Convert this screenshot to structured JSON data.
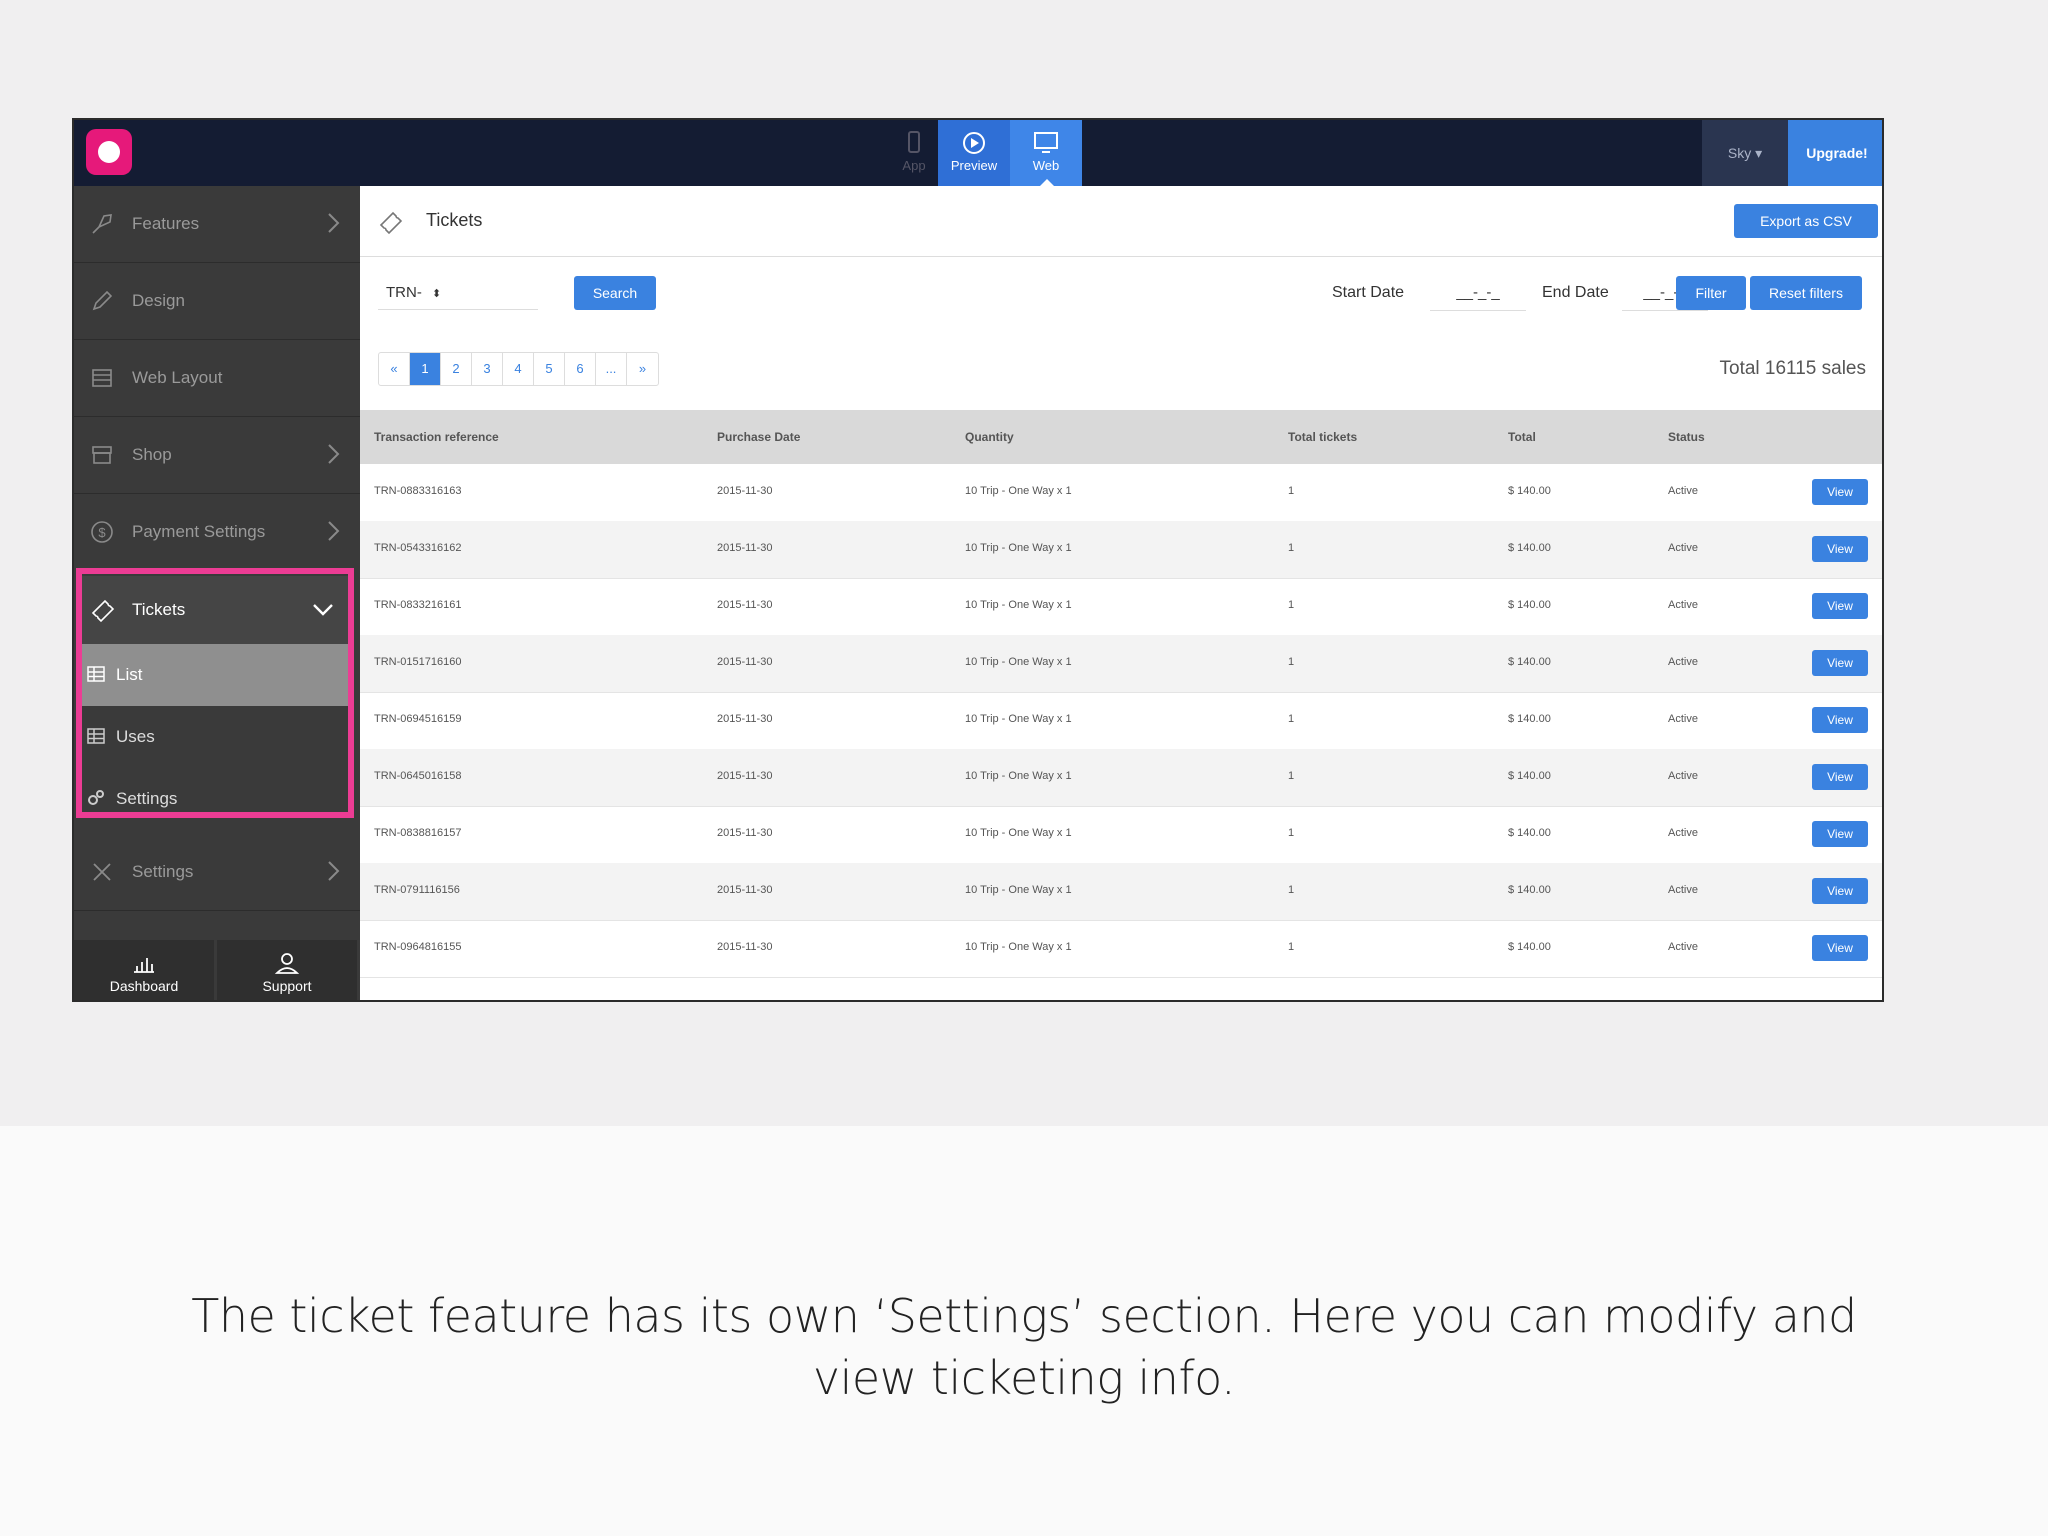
{
  "topbar": {
    "modes": {
      "app": "App",
      "preview": "Preview",
      "web": "Web"
    },
    "user": "Sky ▾",
    "upgrade": "Upgrade!"
  },
  "sidebar": {
    "items": [
      {
        "label": "Features"
      },
      {
        "label": "Design"
      },
      {
        "label": "Web Layout"
      },
      {
        "label": "Shop"
      },
      {
        "label": "Payment Settings"
      }
    ],
    "tickets": {
      "label": "Tickets",
      "sub": [
        {
          "label": "List"
        },
        {
          "label": "Uses"
        },
        {
          "label": "Settings"
        }
      ]
    },
    "settings": {
      "label": "Settings"
    },
    "bottom": {
      "dashboard": "Dashboard",
      "support": "Support"
    }
  },
  "main": {
    "title": "Tickets",
    "export_label": "Export as CSV",
    "prefix_value": "TRN-",
    "search_label": "Search",
    "start_date_label": "Start Date",
    "start_date_value": "__-_-_",
    "end_date_label": "End Date",
    "end_date_value": "__-_-_",
    "filter_label": "Filter",
    "reset_label": "Reset filters",
    "pagination": [
      "«",
      "1",
      "2",
      "3",
      "4",
      "5",
      "6",
      "...",
      "»"
    ],
    "current_page": "1",
    "total_text": "Total 16115 sales"
  },
  "table": {
    "columns": [
      "Transaction reference",
      "Purchase Date",
      "Quantity",
      "Total tickets",
      "Total",
      "Status"
    ],
    "view_label": "View",
    "rows": [
      {
        "ref": "TRN-0883316163",
        "date": "2015-11-30",
        "qty": "10 Trip - One Way   x 1",
        "tickets": "1",
        "total": "$ 140.00",
        "status": "Active"
      },
      {
        "ref": "TRN-0543316162",
        "date": "2015-11-30",
        "qty": "10 Trip - One Way   x 1",
        "tickets": "1",
        "total": "$ 140.00",
        "status": "Active"
      },
      {
        "ref": "TRN-0833216161",
        "date": "2015-11-30",
        "qty": "10 Trip - One Way   x 1",
        "tickets": "1",
        "total": "$ 140.00",
        "status": "Active"
      },
      {
        "ref": "TRN-0151716160",
        "date": "2015-11-30",
        "qty": "10 Trip - One Way   x 1",
        "tickets": "1",
        "total": "$ 140.00",
        "status": "Active"
      },
      {
        "ref": "TRN-0694516159",
        "date": "2015-11-30",
        "qty": "10 Trip - One Way   x 1",
        "tickets": "1",
        "total": "$ 140.00",
        "status": "Active"
      },
      {
        "ref": "TRN-0645016158",
        "date": "2015-11-30",
        "qty": "10 Trip - One Way   x 1",
        "tickets": "1",
        "total": "$ 140.00",
        "status": "Active"
      },
      {
        "ref": "TRN-0838816157",
        "date": "2015-11-30",
        "qty": "10 Trip - One Way   x 1",
        "tickets": "1",
        "total": "$ 140.00",
        "status": "Active"
      },
      {
        "ref": "TRN-0791116156",
        "date": "2015-11-30",
        "qty": "10 Trip - One Way   x 1",
        "tickets": "1",
        "total": "$ 140.00",
        "status": "Active"
      },
      {
        "ref": "TRN-0964816155",
        "date": "2015-11-30",
        "qty": "10 Trip - One Way   x 1",
        "tickets": "1",
        "total": "$ 140.00",
        "status": "Active"
      }
    ]
  },
  "caption": {
    "line1": "The ticket feature has its own ‘Settings’ section. Here you can modify and",
    "line2": "view ticketing info."
  },
  "colors": {
    "accent": "#3a82e0",
    "brand": "#e6197a",
    "highlight": "#ec3c94",
    "topbar": "#141c33",
    "sidebar": "#3a3a3a"
  },
  "icons": {
    "features": "rocket-icon",
    "design": "pencil-icon",
    "web_layout": "layout-icon",
    "shop": "store-icon",
    "payment": "dollar-icon",
    "tickets": "ticket-icon",
    "list": "table-icon",
    "uses": "table-icon",
    "settings_sub": "gears-icon",
    "settings": "tools-icon",
    "dashboard": "chart-icon",
    "support": "user-icon"
  }
}
